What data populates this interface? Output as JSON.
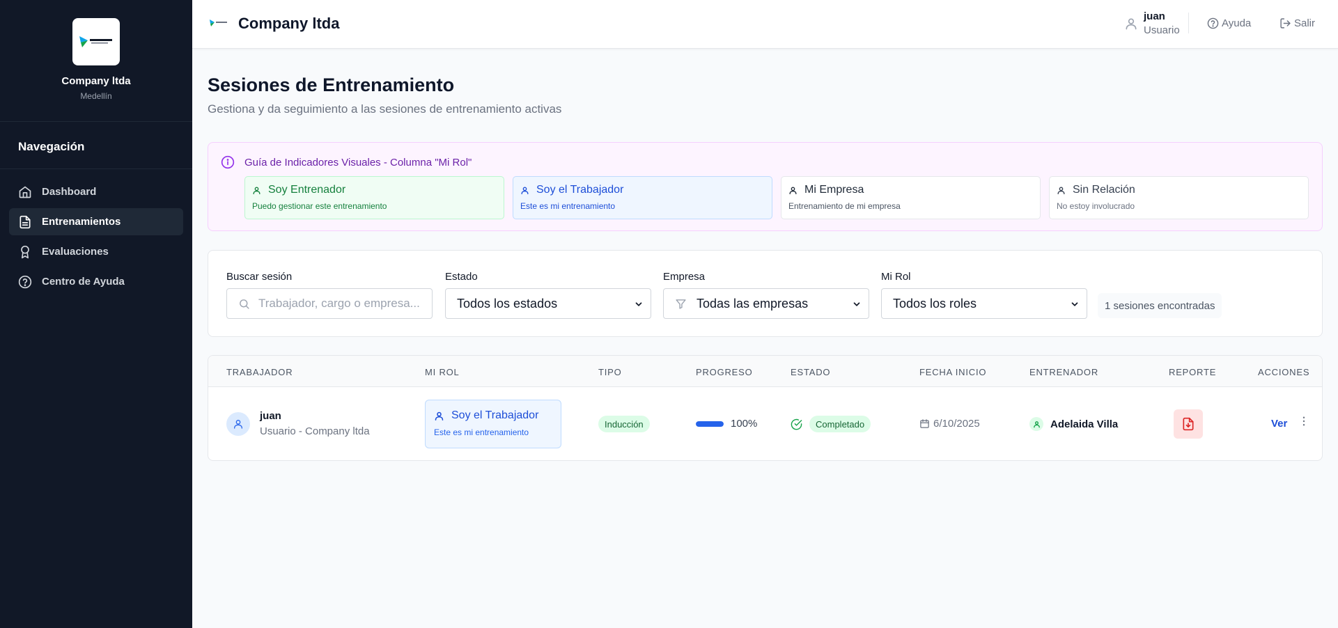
{
  "sidebar": {
    "brand_name": "Company ltda",
    "brand_city": "Medellín",
    "nav_title": "Navegación",
    "items": [
      {
        "label": "Dashboard",
        "icon": "home-icon"
      },
      {
        "label": "Entrenamientos",
        "icon": "document-icon",
        "active": true
      },
      {
        "label": "Evaluaciones",
        "icon": "award-icon"
      },
      {
        "label": "Centro de Ayuda",
        "icon": "help-circle-icon"
      }
    ]
  },
  "header": {
    "title": "Company ltda",
    "user_name": "juan",
    "user_role": "Usuario",
    "help_label": "Ayuda",
    "logout_label": "Salir"
  },
  "main": {
    "title": "Sesiones de Entrenamiento",
    "subtitle": "Gestiona y da seguimiento a las sesiones de entrenamiento activas"
  },
  "guide": {
    "title": "Guía de Indicadores Visuales - Columna \"Mi Rol\"",
    "cards": [
      {
        "title": "Soy Entrenador",
        "desc": "Puedo gestionar este entrenamiento",
        "color": "#15803d"
      },
      {
        "title": "Soy el Trabajador",
        "desc": "Este es mi entrenamiento",
        "color": "#1d4ed8"
      },
      {
        "title": "Mi Empresa",
        "desc": "Entrenamiento de mi empresa",
        "color": "#1f2937"
      },
      {
        "title": "Sin Relación",
        "desc": "No estoy involucrado",
        "color": "#374151"
      }
    ]
  },
  "filters": {
    "search_label": "Buscar sesión",
    "search_placeholder": "Trabajador, cargo o empresa...",
    "estado_label": "Estado",
    "estado_value": "Todos los estados",
    "empresa_label": "Empresa",
    "empresa_value": "Todas las empresas",
    "rol_label": "Mi Rol",
    "rol_value": "Todos los roles",
    "count_text": "1 sesiones encontradas"
  },
  "table": {
    "headers": [
      "TRABAJADOR",
      "MI ROL",
      "TIPO",
      "PROGRESO",
      "ESTADO",
      "FECHA INICIO",
      "ENTRENADOR",
      "REPORTE",
      "ACCIONES"
    ],
    "rows": [
      {
        "worker_name": "juan",
        "worker_sub": "Usuario - Company ltda",
        "role_title": "Soy el Trabajador",
        "role_desc": "Este es mi entrenamiento",
        "tipo": "Inducción",
        "progress": 100,
        "progress_text": "100%",
        "estado": "Completado",
        "fecha": "6/10/2025",
        "trainer": "Adelaida Villa",
        "action_label": "Ver"
      }
    ]
  }
}
